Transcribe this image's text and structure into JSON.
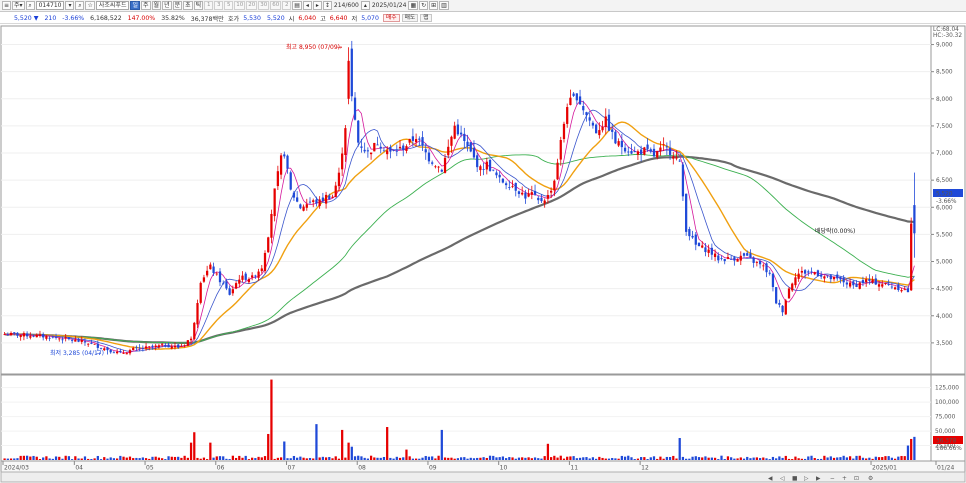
{
  "toolbar": {
    "code": "014710",
    "name": "사조씨푸드",
    "period_buttons": [
      "주",
      "월",
      "년",
      "분",
      "초",
      "틱"
    ],
    "minute_buttons": [
      "1",
      "3",
      "5",
      "10",
      "20",
      "30",
      "60",
      "2"
    ],
    "count": "214/600",
    "date": "2025/01/24"
  },
  "quote": {
    "price": "5,520",
    "change": "210",
    "change_pct": "-3.66%",
    "volume": "6,168,522",
    "volume_ratio": "147.00%",
    "turnover": "35.82%",
    "amount": "36,378백만",
    "ask_label": "호가",
    "ask": "5,530",
    "bid": "5,520",
    "open_label": "시",
    "open": "6,040",
    "high_label": "고",
    "high": "6,640",
    "low_label": "저",
    "low": "5,070",
    "buy_label": "매수",
    "sell_label": "매도",
    "extra_label": "맵"
  },
  "chart_data": {
    "type": "candlestick",
    "price_axis": {
      "min": 3000,
      "max": 9250,
      "ticks": [
        "9,000",
        "8,500",
        "8,000",
        "7,500",
        "7,000",
        "6,500",
        "6,000",
        "5,500",
        "5,000",
        "4,500",
        "4,000",
        "3,500"
      ]
    },
    "volume_axis": {
      "min": 0,
      "max": 140000,
      "ticks": [
        "125,000",
        "100,000",
        "75,000",
        "50,000",
        "25,000"
      ]
    },
    "date_labels": [
      "2024/03",
      "04",
      "05",
      "06",
      "07",
      "08",
      "09",
      "10",
      "11",
      "12",
      "2025/01",
      "01/24"
    ],
    "annotations": {
      "high": "최고 8,950 (07/09)",
      "low": "최저 3,285 (04/17)",
      "dividend": "배당락(0.00%)"
    },
    "right_labels": {
      "lc": "LC:68.04",
      "hc": "HC:-30.32",
      "price": "5,520",
      "price_pct": "-3.66%",
      "volume": "36,378",
      "volume_pct": "186.66%"
    },
    "colors": {
      "up": "#e60000",
      "down": "#1f49d8",
      "ma5": "#d4189c",
      "ma10": "#3a55cc",
      "ma20": "#f0a010",
      "ma60": "#3cb050",
      "ma120": "#6a6a6a"
    },
    "anchors": [
      [
        0,
        3660
      ],
      [
        8,
        3640
      ],
      [
        14,
        3610
      ],
      [
        20,
        3560
      ],
      [
        26,
        3500
      ],
      [
        32,
        3380
      ],
      [
        36,
        3300
      ],
      [
        40,
        3380
      ],
      [
        46,
        3420
      ],
      [
        50,
        3460
      ],
      [
        54,
        3420
      ],
      [
        56,
        3480
      ],
      [
        57,
        3550
      ],
      [
        58,
        3560
      ],
      [
        59,
        3900
      ],
      [
        61,
        4650
      ],
      [
        64,
        4900
      ],
      [
        67,
        4650
      ],
      [
        70,
        4400
      ],
      [
        73,
        4700
      ],
      [
        77,
        4700
      ],
      [
        80,
        4900
      ],
      [
        82,
        5500
      ],
      [
        84,
        6300
      ],
      [
        86,
        6900
      ],
      [
        87,
        7000
      ],
      [
        89,
        6300
      ],
      [
        92,
        6000
      ],
      [
        95,
        6100
      ],
      [
        98,
        6100
      ],
      [
        100,
        6200
      ],
      [
        102,
        6200
      ],
      [
        104,
        6600
      ],
      [
        106,
        7500
      ],
      [
        107,
        8950
      ],
      [
        108,
        8000
      ],
      [
        110,
        7200
      ],
      [
        113,
        7000
      ],
      [
        116,
        7200
      ],
      [
        120,
        7000
      ],
      [
        124,
        7100
      ],
      [
        128,
        7300
      ],
      [
        132,
        6900
      ],
      [
        136,
        6700
      ],
      [
        140,
        7500
      ],
      [
        143,
        7200
      ],
      [
        146,
        6900
      ],
      [
        148,
        6700
      ],
      [
        150,
        6800
      ],
      [
        154,
        6500
      ],
      [
        158,
        6400
      ],
      [
        162,
        6200
      ],
      [
        164,
        6250
      ],
      [
        166,
        6100
      ],
      [
        169,
        6200
      ],
      [
        171,
        6500
      ],
      [
        173,
        7200
      ],
      [
        175,
        7900
      ],
      [
        178,
        8050
      ],
      [
        181,
        7700
      ],
      [
        184,
        7400
      ],
      [
        187,
        7600
      ],
      [
        190,
        7200
      ],
      [
        193,
        7100
      ],
      [
        196,
        7000
      ],
      [
        199,
        7050
      ],
      [
        202,
        6950
      ],
      [
        205,
        7100
      ],
      [
        208,
        7000
      ],
      [
        210,
        6800
      ],
      [
        212,
        5600
      ],
      [
        215,
        5300
      ],
      [
        219,
        5200
      ],
      [
        222,
        5050
      ],
      [
        226,
        5050
      ],
      [
        230,
        5100
      ],
      [
        233,
        5000
      ],
      [
        236,
        4900
      ],
      [
        238,
        4750
      ],
      [
        240,
        4250
      ],
      [
        242,
        4100
      ],
      [
        244,
        4500
      ],
      [
        246,
        4750
      ],
      [
        248,
        4800
      ],
      [
        252,
        4800
      ],
      [
        256,
        4700
      ],
      [
        260,
        4650
      ],
      [
        264,
        4550
      ],
      [
        268,
        4650
      ],
      [
        272,
        4600
      ],
      [
        276,
        4550
      ],
      [
        279,
        4500
      ],
      [
        281,
        4450
      ],
      [
        282,
        5700
      ],
      [
        283,
        5520
      ]
    ],
    "volume_spikes": [
      [
        58,
        30000
      ],
      [
        59,
        48000
      ],
      [
        64,
        30000
      ],
      [
        82,
        45000
      ],
      [
        83,
        139000
      ],
      [
        87,
        32000
      ],
      [
        97,
        62000
      ],
      [
        105,
        52000
      ],
      [
        107,
        30000
      ],
      [
        108,
        23000
      ],
      [
        119,
        57000
      ],
      [
        125,
        18000
      ],
      [
        136,
        52000
      ],
      [
        169,
        28000
      ],
      [
        210,
        38000
      ],
      [
        281,
        25000
      ],
      [
        282,
        36378
      ],
      [
        283,
        40000
      ]
    ],
    "moving_averages": [
      "MA5",
      "MA10",
      "MA20",
      "MA60",
      "MA120"
    ]
  }
}
